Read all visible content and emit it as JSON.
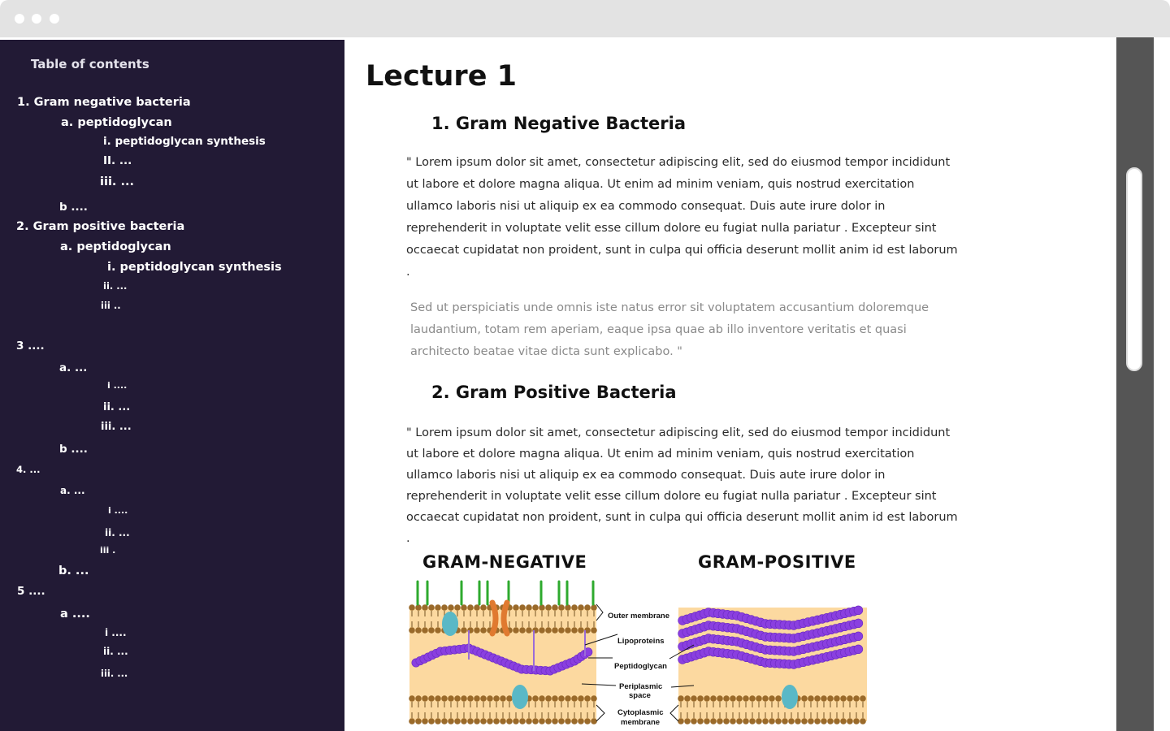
{
  "window": {
    "controls": [
      "close",
      "minimize",
      "maximize"
    ]
  },
  "sidebar": {
    "title": "Table of contents",
    "items": [
      "1. Gram negative bacteria",
      "a. peptidoglycan",
      "i. peptidoglycan synthesis",
      "II. ...",
      "iii. ...",
      "b ....",
      "2. Gram positive bacteria",
      "a. peptidoglycan",
      "i. peptidoglycan synthesis",
      "ii. ...",
      "iii ..",
      "3 ....",
      "a. ...",
      "i ....",
      "ii. ...",
      "iii. ...",
      "b ....",
      "4. ...",
      "a. ...",
      "i ....",
      "ii. ...",
      "iii .",
      "b. ...",
      "5 ....",
      "a ....",
      "i ....",
      "ii. ...",
      "iii. ..."
    ]
  },
  "main": {
    "title": "Lecture 1",
    "sections": [
      {
        "heading": "1. Gram Negative Bacteria",
        "body": "\" Lorem ipsum dolor sit amet, consectetur adipiscing elit, sed do eiusmod tempor incididunt ut labore et dolore magna aliqua. Ut enim ad minim veniam, quis nostrud exercitation ullamco laboris nisi ut aliquip ex ea commodo consequat. Duis aute irure dolor in reprehenderit in voluptate velit esse cillum dolore eu fugiat nulla pariatur . Excepteur sint occaecat cupidatat non proident, sunt in culpa qui officia deserunt mollit anim id est laborum .",
        "quote": "Sed ut perspiciatis unde omnis iste natus error sit voluptatem accusantium doloremque laudantium, totam rem aperiam, eaque ipsa quae ab illo inventore veritatis et quasi architecto beatae vitae dicta sunt explicabo. \""
      },
      {
        "heading": "2. Gram Positive Bacteria",
        "body": "\" Lorem ipsum dolor sit amet, consectetur adipiscing elit, sed do eiusmod tempor incididunt ut labore et dolore magna aliqua. Ut enim ad minim veniam, quis nostrud exercitation ullamco laboris nisi ut aliquip ex ea commodo consequat. Duis aute irure dolor in reprehenderit in voluptate velit esse cillum dolore eu fugiat nulla pariatur . Excepteur sint occaecat cupidatat non proident, sunt in culpa qui officia deserunt mollit anim id est laborum ."
      }
    ],
    "figure": {
      "left_title": "GRAM-NEGATIVE",
      "right_title": "GRAM-POSITIVE",
      "labels": [
        "Outer membrane",
        "Lipoproteins",
        "Peptidoglycan",
        "Periplasmic",
        "space",
        "Cytoplasmic",
        "membrane"
      ]
    }
  },
  "colors": {
    "sidebar_bg": "#221a35",
    "scrollbar_track": "#555555",
    "peptidoglycan": "#8a3fe0",
    "lipid_head": "#9a6a2a",
    "periplasm": "#fcd9a0",
    "protein": "#5ab8c6",
    "porin": "#e07a30",
    "lps": "#2eaa2e"
  }
}
